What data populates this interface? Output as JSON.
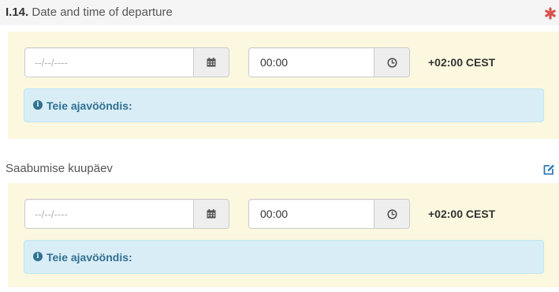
{
  "departure": {
    "number": "I.14.",
    "title": "Date and time of departure",
    "date_placeholder": "--/--/----",
    "time_value": "00:00",
    "timezone": "+02:00 CEST",
    "info_text": "Teie ajavööndis:"
  },
  "arrival": {
    "title": "Saabumise kuupäev",
    "date_placeholder": "--/--/----",
    "time_value": "00:00",
    "timezone": "+02:00 CEST",
    "info_text": "Teie ajavööndis:"
  },
  "icons": {
    "required": "asterisk-icon",
    "calendar": "calendar-icon",
    "clock": "clock-icon",
    "info": "info-circle-icon",
    "edit": "edit-icon"
  },
  "colors": {
    "panel_bg": "#fbf8df",
    "header_bg": "#f5f5f5",
    "required": "#d9534f",
    "edit": "#337ab7",
    "info_bg": "#d9edf7",
    "info_text": "#31708f"
  }
}
